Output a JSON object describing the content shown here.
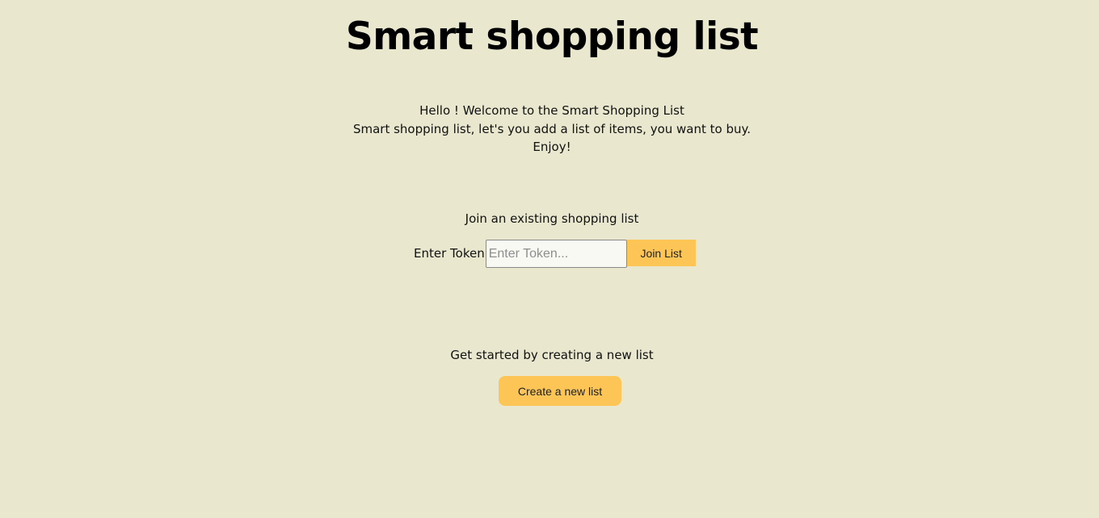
{
  "page": {
    "title": "Smart shopping list"
  },
  "intro": {
    "line1": "Hello ! Welcome to the Smart Shopping List",
    "line2": "Smart shopping list, let's you add a list of items, you want to buy.",
    "line3": "Enjoy!"
  },
  "join": {
    "heading": "Join an existing shopping list",
    "label": "Enter Token",
    "input_value": "",
    "input_placeholder": "Enter Token...",
    "button_label": "Join List"
  },
  "create": {
    "heading": "Get started by creating a new list",
    "button_label": "Create a new list"
  },
  "colors": {
    "background": "#e9e8cf",
    "accent": "#fcc556"
  }
}
